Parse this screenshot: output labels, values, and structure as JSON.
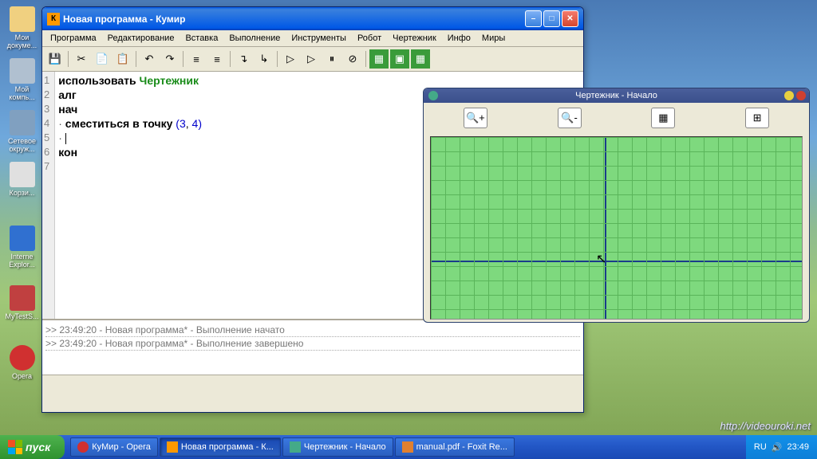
{
  "desktop": {
    "icons": [
      {
        "label": "Мои\nдокуме..."
      },
      {
        "label": "Мой\nкомпь..."
      },
      {
        "label": "Сетевое\nокруж..."
      },
      {
        "label": "Корзи..."
      },
      {
        "label": "Interne\nExplor..."
      },
      {
        "label": "MyTestS..."
      },
      {
        "label": "Opera"
      }
    ]
  },
  "window": {
    "title": "Новая программа - Кумир",
    "icon_letter": "К",
    "menu": [
      "Программа",
      "Редактирование",
      "Вставка",
      "Выполнение",
      "Инструменты",
      "Робот",
      "Чертежник",
      "Инфо",
      "Миры"
    ],
    "lines": [
      "1",
      "2",
      "3",
      "4",
      "5",
      "6",
      "7"
    ],
    "code": {
      "l1_kw": "использовать",
      "l1_id": "Чертежник",
      "l2": "алг",
      "l3": "нач",
      "l4_dot": "·",
      "l4_cmd": "сместиться в точку",
      "l4_p1": "(",
      "l4_n1": "3",
      "l4_c": ", ",
      "l4_n2": "4",
      "l4_p2": ")",
      "l5_dot": "·",
      "l6": "кон"
    },
    "console": {
      "l1": ">> 23:49:20 - Новая программа* - Выполнение начато",
      "l2": ">> 23:49:20 - Новая программа* - Выполнение завершено"
    }
  },
  "subwindow": {
    "title": "Чертежник - Начало"
  },
  "taskbar": {
    "start": "пуск",
    "items": [
      {
        "label": "КуМир - Opera"
      },
      {
        "label": "Новая программа - К..."
      },
      {
        "label": "Чертежник - Начало"
      },
      {
        "label": "manual.pdf - Foxit Re..."
      }
    ],
    "lang": "RU",
    "time": "23:49"
  },
  "watermark": "http://videouroki.net"
}
